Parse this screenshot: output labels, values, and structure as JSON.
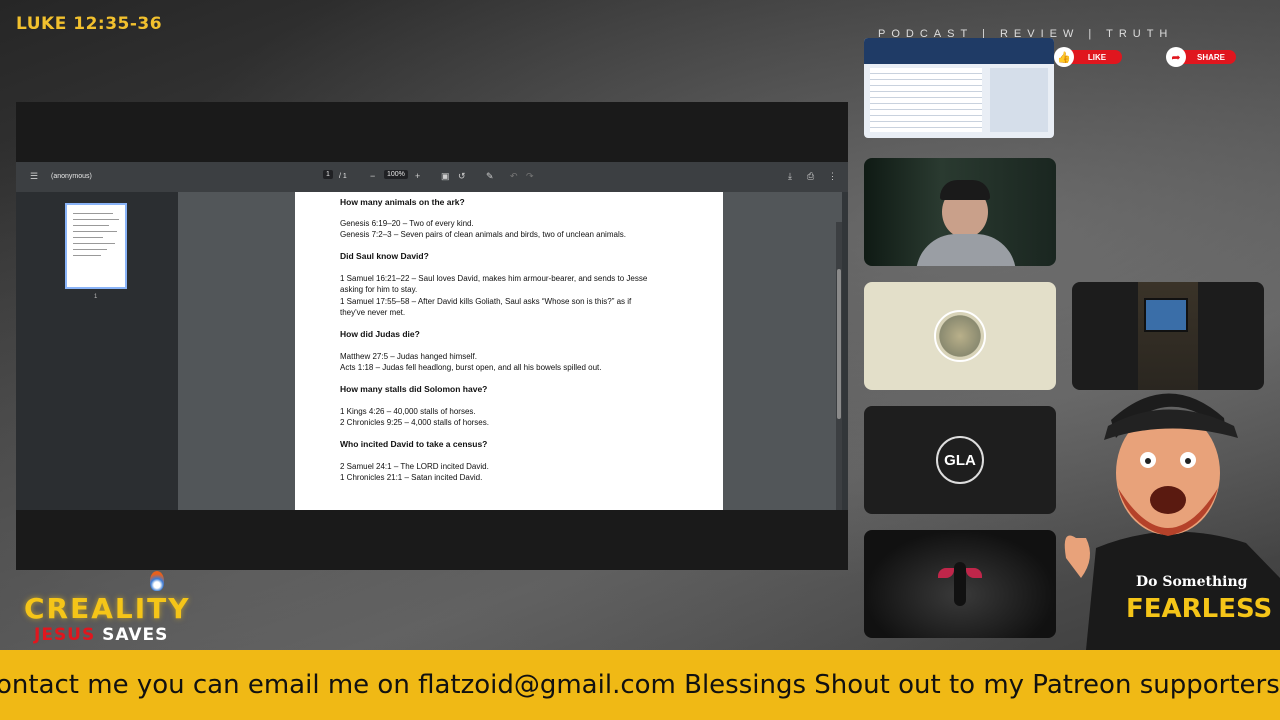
{
  "overlay": {
    "verse": "LUKE 12:35-36",
    "header": "PODCAST | REVIEW | TRUTH",
    "like_label": "LIKE",
    "share_label": "SHARE",
    "logo_top": "CREALITY",
    "logo_jesus": "JESUS",
    "logo_saves": "SAVES",
    "ticker": "ontact me you can email me on flatzoid@gmail.com  Blessings   Shout out to my Patreon supporters",
    "gla": "GLA",
    "shirt_line1": "Do Something",
    "shirt_line2": "FEARLESS"
  },
  "viewer": {
    "doc_title": "(anonymous)",
    "page_current": "1",
    "page_total": "/ 1",
    "zoom": "100%",
    "thumb_number": "1"
  },
  "page": {
    "q1": "How many animals on the ark?",
    "a1_l1": "Genesis 6:19–20 – Two of every kind.",
    "a1_l2": "Genesis 7:2–3 – Seven pairs of clean animals and birds, two of unclean animals.",
    "q2": "Did Saul know David?",
    "a2_l1": "1 Samuel 16:21–22 – Saul loves David, makes him armour-bearer, and sends to Jesse",
    "a2_l2": "asking for him to stay.",
    "a2_l3": "1 Samuel 17:55–58 – After David kills Goliath, Saul asks “Whose son is this?” as if",
    "a2_l4": "they've never met.",
    "q3": "How did Judas die?",
    "a3_l1": "Matthew 27:5 – Judas hanged himself.",
    "a3_l2": "Acts 1:18 – Judas fell headlong, burst open, and all his bowels spilled out.",
    "q4": "How many stalls did Solomon have?",
    "a4_l1": "1 Kings 4:26 – 40,000 stalls of horses.",
    "a4_l2": "2 Chronicles 9:25 – 4,000 stalls of horses.",
    "q5": "Who incited David to take a census?",
    "a5_l1": "2 Samuel 24:1 – The LORD incited David.",
    "a5_l2": "1 Chronicles 21:1 – Satan incited David."
  },
  "colors": {
    "accent_yellow": "#f0b915",
    "logo_red": "#e0161e",
    "viewer_bg": "#323639"
  }
}
